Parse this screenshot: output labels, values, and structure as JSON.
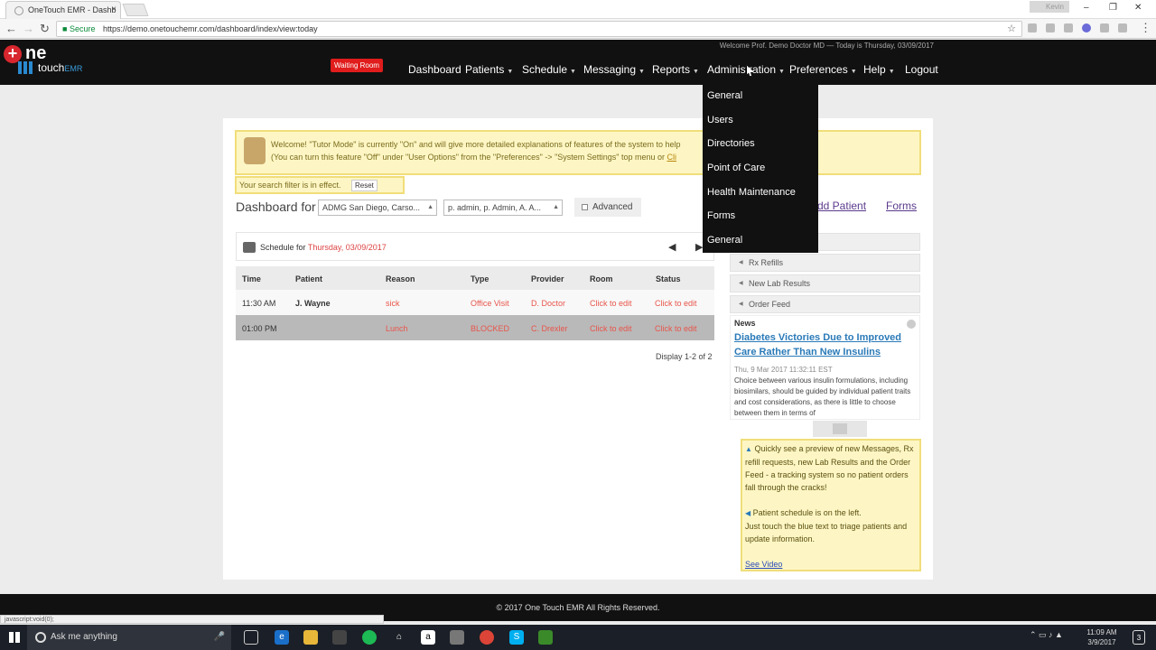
{
  "browser": {
    "tab_title": "OneTouch EMR - Dashb",
    "tab_close": "×",
    "profile": "Kevin",
    "security_label": "Secure",
    "url": "https://demo.onetouchemr.com/dashboard/index/view:today",
    "win_minimize": "–",
    "win_restore": "❐",
    "win_close": "✕",
    "nav_back": "←",
    "nav_forward": "→",
    "nav_reload": "↻",
    "bookmark_star": "☆",
    "status_url": "javascript:void(0);"
  },
  "header": {
    "welcome": "Welcome Prof. Demo Doctor MD — Today is Thursday, 03/09/2017",
    "logo": {
      "one": "ne",
      "touch": "touch",
      "emr": "EMR"
    },
    "waiting_room": "Waiting Room",
    "nav": [
      {
        "label": "Dashboard"
      },
      {
        "label": "Patients"
      },
      {
        "label": "Schedule"
      },
      {
        "label": "Messaging"
      },
      {
        "label": "Reports"
      },
      {
        "label": "Administration"
      },
      {
        "label": "Preferences"
      },
      {
        "label": "Help"
      },
      {
        "label": "Logout"
      }
    ]
  },
  "admin_menu": [
    "General",
    "Users",
    "Directories",
    "Point of Care",
    "Health Maintenance",
    "Forms",
    "General"
  ],
  "tutor": {
    "line1": "Welcome! \"Tutor Mode\" is currently \"On\" and will give more detailed explanations of features of the system to help",
    "line2": "(You can turn this feature \"Off\" under \"User Options\" from the \"Preferences\" -> \"System Settings\" top menu or",
    "link": "Cli"
  },
  "filter": {
    "text": "Your search filter is in effect.",
    "reset": "Reset"
  },
  "dashboard": {
    "label": "Dashboard for",
    "location": "ADMG San Diego, Carso...",
    "providers": "p. admin, p. Admin, A. A...",
    "advanced": "Advanced",
    "add_patient": "dd Patient",
    "forms": "Forms"
  },
  "schedule": {
    "label": "Schedule for",
    "date": "Thursday, 03/09/2017",
    "prev": "◀",
    "next": "▶",
    "columns": [
      "Time",
      "Patient",
      "Reason",
      "Type",
      "Provider",
      "Room",
      "Status"
    ],
    "rows": [
      {
        "time": "11:30 AM",
        "patient": "J. Wayne",
        "reason": "sick",
        "type": "Office Visit",
        "provider": "D. Doctor",
        "room": "Click to edit",
        "status": "Click to edit"
      },
      {
        "time": "01:00 PM",
        "patient": "",
        "reason": "Lunch",
        "type": "BLOCKED",
        "provider": "C. Drexler",
        "room": "Click to edit",
        "status": "Click to edit"
      }
    ],
    "display": "Display 1-2 of 2"
  },
  "sidebar": {
    "panels": [
      "Rx Refills",
      "New Lab Results",
      "Order Feed"
    ],
    "news": {
      "heading": "News",
      "title": "Diabetes Victories Due to Improved Care Rather Than New Insulins",
      "time": "Thu, 9 Mar 2017 11:32:11 EST",
      "body": "Choice between various insulin formulations, including biosimilars, should be guided by individual patient traits and cost considerations, as there is little to choose between them in terms of"
    },
    "tip": {
      "p1": "Quickly see a preview of new Messages, Rx refill requests, new Lab Results and the Order Feed - a tracking system so no patient orders fall through the cracks!",
      "p2a": "Patient schedule is on the left.",
      "p2b": "Just touch the blue text to triage patients and update information.",
      "video": "See Video"
    }
  },
  "footer": "© 2017 One Touch EMR All Rights Reserved.",
  "taskbar": {
    "search": "Ask me anything",
    "time": "11:09 AM",
    "date": "3/9/2017",
    "notifications": "3"
  },
  "colors": {
    "accent_red": "#e01c1c",
    "link_blue": "#2a7ab8",
    "tutor_bg": "#fdf6c4"
  }
}
